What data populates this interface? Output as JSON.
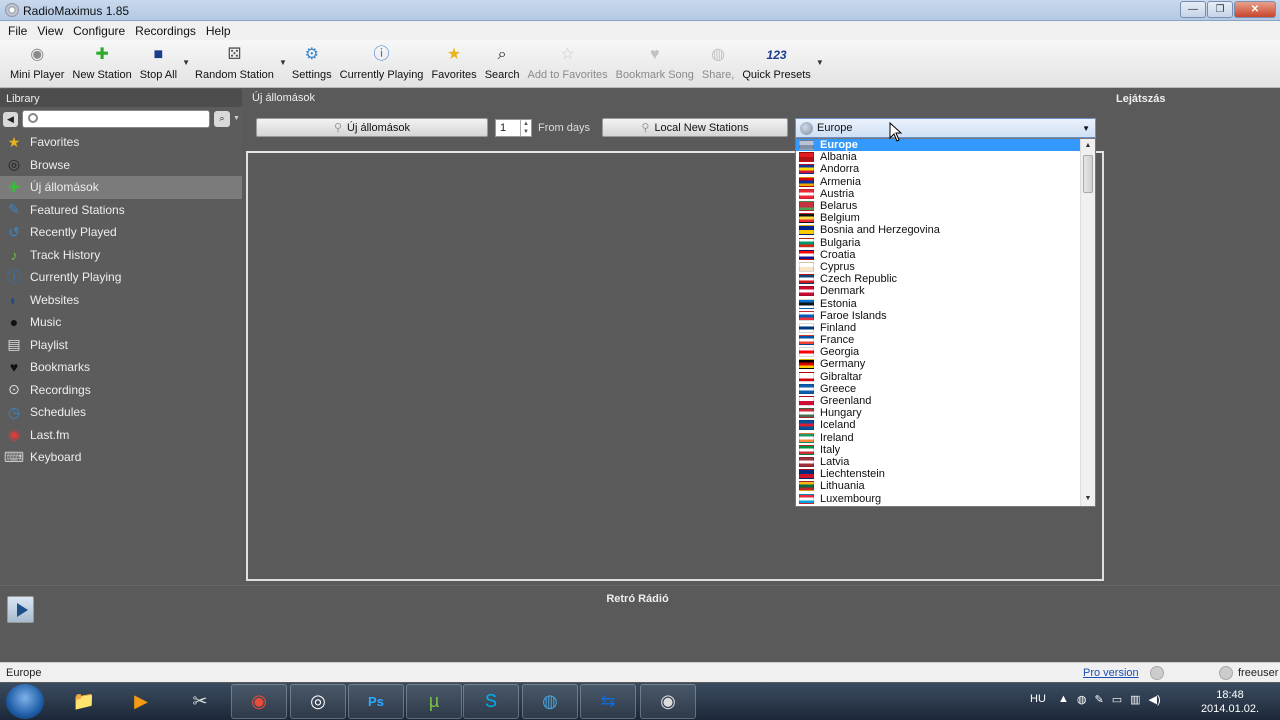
{
  "window": {
    "title": "RadioMaximus 1.85",
    "controls": [
      "—",
      "❐",
      "✕"
    ]
  },
  "menu": [
    "File",
    "View",
    "Configure",
    "Recordings",
    "Help"
  ],
  "toolbar": [
    {
      "label": "Mini Player",
      "icon": "antenna-icon",
      "glyph": "◉",
      "color": "#8a8a8a"
    },
    {
      "label": "New Station",
      "icon": "plus-icon",
      "glyph": "✚",
      "color": "#2fa82f"
    },
    {
      "label": "Stop All",
      "icon": "stop-icon",
      "glyph": "■",
      "color": "#1c3c8c"
    },
    {
      "label": "Random Station",
      "icon": "dice-icon",
      "glyph": "⚄",
      "color": "#555"
    },
    {
      "label": "Settings",
      "icon": "gear-icon",
      "glyph": "⚙",
      "color": "#3a86c8"
    },
    {
      "label": "Currently Playing",
      "icon": "info-icon",
      "glyph": "ⓘ",
      "color": "#2b78d0"
    },
    {
      "label": "Favorites",
      "icon": "star-icon",
      "glyph": "★",
      "color": "#e9b51c"
    },
    {
      "label": "Search",
      "icon": "binoculars-icon",
      "glyph": "⌕",
      "color": "#222"
    },
    {
      "label": "Add to Favorites",
      "icon": "star-outline-icon",
      "glyph": "☆",
      "color": "#999",
      "disabled": true
    },
    {
      "label": "Bookmark Song",
      "icon": "heart-icon",
      "glyph": "♥",
      "color": "#888",
      "disabled": true
    },
    {
      "label": "Share,",
      "icon": "share-icon",
      "glyph": "◍",
      "color": "#888",
      "disabled": true
    },
    {
      "label": "Quick Presets",
      "icon": "presets-icon",
      "glyph": "123",
      "color": "#1c3c8c"
    }
  ],
  "library": {
    "header": "Library",
    "items": [
      {
        "label": "Favorites",
        "icon": "star-icon",
        "glyph": "★",
        "color": "#e9b51c"
      },
      {
        "label": "Browse",
        "icon": "binoculars-icon",
        "glyph": "◎",
        "color": "#222"
      },
      {
        "label": "Új állomások",
        "icon": "plus-icon",
        "glyph": "✚",
        "color": "#3bbb3b",
        "active": true
      },
      {
        "label": "Featured Stations",
        "icon": "featured-icon",
        "glyph": "✎",
        "color": "#3a86c8"
      },
      {
        "label": "Recently Played",
        "icon": "recent-icon",
        "glyph": "↺",
        "color": "#3a86c8"
      },
      {
        "label": "Track History",
        "icon": "track-history-icon",
        "glyph": "♪",
        "color": "#6cbd3c"
      },
      {
        "label": "Currently Playing",
        "icon": "info-icon",
        "glyph": "ⓘ",
        "color": "#2b78d0"
      },
      {
        "label": "Websites",
        "icon": "globe-icon",
        "glyph": "◐",
        "color": "#1c4a8c"
      },
      {
        "label": "Music",
        "icon": "music-icon",
        "glyph": "●",
        "color": "#111"
      },
      {
        "label": "Playlist",
        "icon": "playlist-icon",
        "glyph": "▤",
        "color": "#ddd"
      },
      {
        "label": "Bookmarks",
        "icon": "heart-icon",
        "glyph": "♥",
        "color": "#111"
      },
      {
        "label": "Recordings",
        "icon": "recordings-icon",
        "glyph": "⊙",
        "color": "#ddd"
      },
      {
        "label": "Schedules",
        "icon": "clock-icon",
        "glyph": "◷",
        "color": "#3a86c8"
      },
      {
        "label": "Last.fm",
        "icon": "lastfm-icon",
        "glyph": "◉",
        "color": "#d93c3c"
      },
      {
        "label": "Keyboard",
        "icon": "keyboard-icon",
        "glyph": "⌨",
        "color": "#ccc"
      }
    ]
  },
  "main": {
    "title": "Új állomások",
    "new_stations_button": "Új állomások",
    "days_value": "1",
    "from_days_label": "From days",
    "local_button": "Local New Stations",
    "region": "Europe",
    "dropdown": [
      {
        "name": "Europe",
        "colors": [
          "#b8c3d4",
          "#8090a8"
        ],
        "selected": true
      },
      {
        "name": "Albania",
        "colors": [
          "#e41e20",
          "#b01216"
        ]
      },
      {
        "name": "Andorra",
        "colors": [
          "#1038a0",
          "#fedf00",
          "#d0103a"
        ]
      },
      {
        "name": "Armenia",
        "colors": [
          "#d90012",
          "#0033a0",
          "#f2a800"
        ]
      },
      {
        "name": "Austria",
        "colors": [
          "#ed2939",
          "#ffffff",
          "#ed2939"
        ]
      },
      {
        "name": "Belarus",
        "colors": [
          "#c8313e",
          "#c8313e",
          "#4aa657"
        ]
      },
      {
        "name": "Belgium",
        "colors": [
          "#111111",
          "#fae042",
          "#ed2939"
        ]
      },
      {
        "name": "Bosnia and Herzegovina",
        "colors": [
          "#002395",
          "#fecb00"
        ]
      },
      {
        "name": "Bulgaria",
        "colors": [
          "#ffffff",
          "#00966e",
          "#d62612"
        ]
      },
      {
        "name": "Croatia",
        "colors": [
          "#ff0000",
          "#ffffff",
          "#171796"
        ]
      },
      {
        "name": "Cyprus",
        "colors": [
          "#ffffff",
          "#f7e6c4"
        ]
      },
      {
        "name": "Czech Republic",
        "colors": [
          "#11457e",
          "#ffffff",
          "#d7141a"
        ]
      },
      {
        "name": "Denmark",
        "colors": [
          "#c60c30",
          "#ffffff",
          "#c60c30"
        ]
      },
      {
        "name": "Estonia",
        "colors": [
          "#0072ce",
          "#111111",
          "#ffffff"
        ]
      },
      {
        "name": "Faroe Islands",
        "colors": [
          "#ffffff",
          "#005eb8",
          "#ef303e"
        ]
      },
      {
        "name": "Finland",
        "colors": [
          "#ffffff",
          "#003580",
          "#ffffff"
        ]
      },
      {
        "name": "France",
        "colors": [
          "#0055a4",
          "#ffffff",
          "#ef4135"
        ]
      },
      {
        "name": "Georgia",
        "colors": [
          "#ffffff",
          "#ff0000",
          "#ffffff"
        ]
      },
      {
        "name": "Germany",
        "colors": [
          "#000000",
          "#dd0000",
          "#ffce00"
        ]
      },
      {
        "name": "Gibraltar",
        "colors": [
          "#ffffff",
          "#ffffff",
          "#da000c"
        ]
      },
      {
        "name": "Greece",
        "colors": [
          "#0d5eaf",
          "#ffffff",
          "#0d5eaf"
        ]
      },
      {
        "name": "Greenland",
        "colors": [
          "#ffffff",
          "#d00c33"
        ]
      },
      {
        "name": "Hungary",
        "colors": [
          "#ce2939",
          "#ffffff",
          "#477050"
        ]
      },
      {
        "name": "Iceland",
        "colors": [
          "#02529c",
          "#dc1e35",
          "#02529c"
        ]
      },
      {
        "name": "Ireland",
        "colors": [
          "#169b62",
          "#ffffff",
          "#ff883e"
        ]
      },
      {
        "name": "Italy",
        "colors": [
          "#009246",
          "#ffffff",
          "#ce2b37"
        ]
      },
      {
        "name": "Latvia",
        "colors": [
          "#9e3039",
          "#ffffff",
          "#9e3039"
        ]
      },
      {
        "name": "Liechtenstein",
        "colors": [
          "#002b7f",
          "#ce1126"
        ]
      },
      {
        "name": "Lithuania",
        "colors": [
          "#fdb913",
          "#006a44",
          "#c1272d"
        ]
      },
      {
        "name": "Luxembourg",
        "colors": [
          "#ed2939",
          "#ffffff",
          "#00a1de"
        ]
      }
    ]
  },
  "right_panel": {
    "title": "Lejátszás"
  },
  "player": {
    "station": "Retró Rádió"
  },
  "statusbar": {
    "text": "Europe",
    "pro_link": "Pro version",
    "user": "freeuser"
  },
  "taskbar": {
    "apps": [
      {
        "name": "explorer",
        "glyph": "📁"
      },
      {
        "name": "media-player",
        "glyph": "▶"
      },
      {
        "name": "snipping-tool",
        "glyph": "✂"
      },
      {
        "name": "chrome",
        "glyph": "◉"
      },
      {
        "name": "safari",
        "glyph": "◎"
      },
      {
        "name": "photoshop",
        "glyph": "Ps"
      },
      {
        "name": "utorrent",
        "glyph": "µ"
      },
      {
        "name": "skype",
        "glyph": "S"
      },
      {
        "name": "network-app",
        "glyph": "◍"
      },
      {
        "name": "teamviewer",
        "glyph": "⇆"
      },
      {
        "name": "radiomaximus",
        "glyph": "◉"
      }
    ],
    "lang": "HU",
    "time": "18:48",
    "date": "2014.01.02."
  }
}
